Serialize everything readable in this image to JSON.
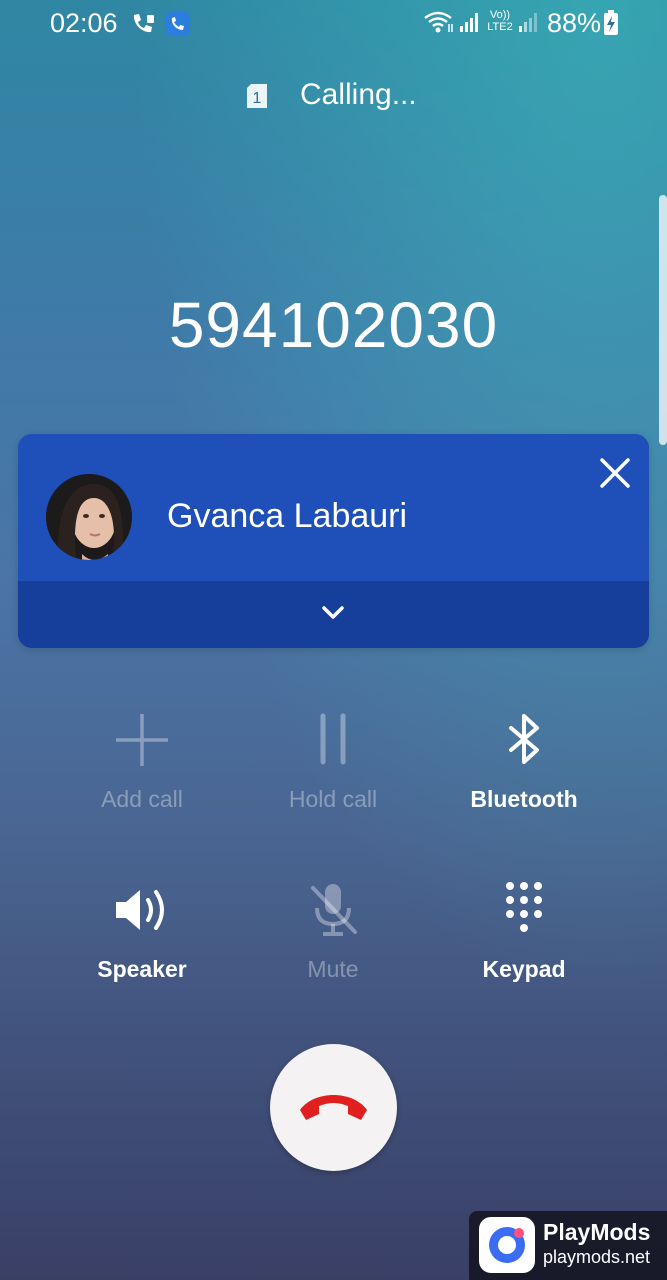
{
  "status_bar": {
    "time": "02:06",
    "volte_label": "Vo))",
    "lte_label": "LTE2",
    "battery_percent": "88%"
  },
  "header": {
    "sim_slot": "1",
    "call_status": "Calling..."
  },
  "call": {
    "number": "594102030"
  },
  "contact_card": {
    "name": "Gvanca Labauri",
    "colors": {
      "top": "#1f4fb8",
      "bottom": "#163f9c"
    }
  },
  "controls": [
    {
      "id": "add-call",
      "label": "Add call",
      "icon": "plus-icon",
      "enabled": false
    },
    {
      "id": "hold-call",
      "label": "Hold call",
      "icon": "pause-icon",
      "enabled": false
    },
    {
      "id": "bluetooth",
      "label": "Bluetooth",
      "icon": "bluetooth-icon",
      "enabled": true
    },
    {
      "id": "speaker",
      "label": "Speaker",
      "icon": "speaker-icon",
      "enabled": true
    },
    {
      "id": "mute",
      "label": "Mute",
      "icon": "mic-off-icon",
      "enabled": false
    },
    {
      "id": "keypad",
      "label": "Keypad",
      "icon": "keypad-icon",
      "enabled": true
    }
  ],
  "end_call": {
    "icon": "phone-hangup-icon",
    "color": "#e0201e"
  },
  "watermark": {
    "title": "PlayMods",
    "subtitle": "playmods.net"
  }
}
